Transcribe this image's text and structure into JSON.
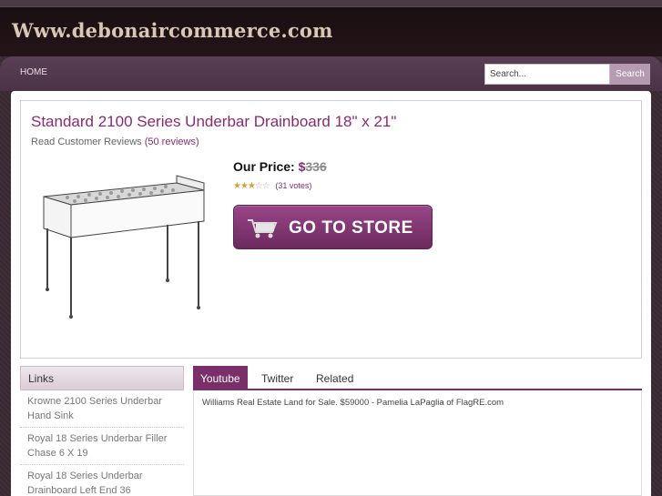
{
  "header": {
    "site_title": "Www.debonaircommerce.com"
  },
  "nav": {
    "home_label": "HOME",
    "search_placeholder": "Search...",
    "search_button_label": "Search"
  },
  "product": {
    "title": "Standard 2100 Series Underbar Drainboard 18\" x 21\"",
    "reviews_prefix": "Read Customer Reviews",
    "reviews_link": "(50 reviews)",
    "price_label": "Our Price:",
    "price_currency": "$",
    "price_value": "336",
    "rating_stars": 3.5,
    "votes": "(31 votes)",
    "store_button_label": "GO TO STORE",
    "colors": {
      "accent": "#8a2a72",
      "button": "#7a3170"
    }
  },
  "sidebar": {
    "header": "Links",
    "items": [
      "Krowne 2100 Series Underbar Hand Sink",
      "Royal 18 Series Underbar Filler Chase 6 X 19",
      "Royal 18 Series Underbar Drainboard Left End 36"
    ]
  },
  "tabs": {
    "items": [
      "Youtube",
      "Twitter",
      "Related"
    ],
    "active": "Youtube",
    "panel_text": "Williams Real Estate Land for Sale. $59000 - Pamelia LaPaglia of FlagRE.com"
  }
}
